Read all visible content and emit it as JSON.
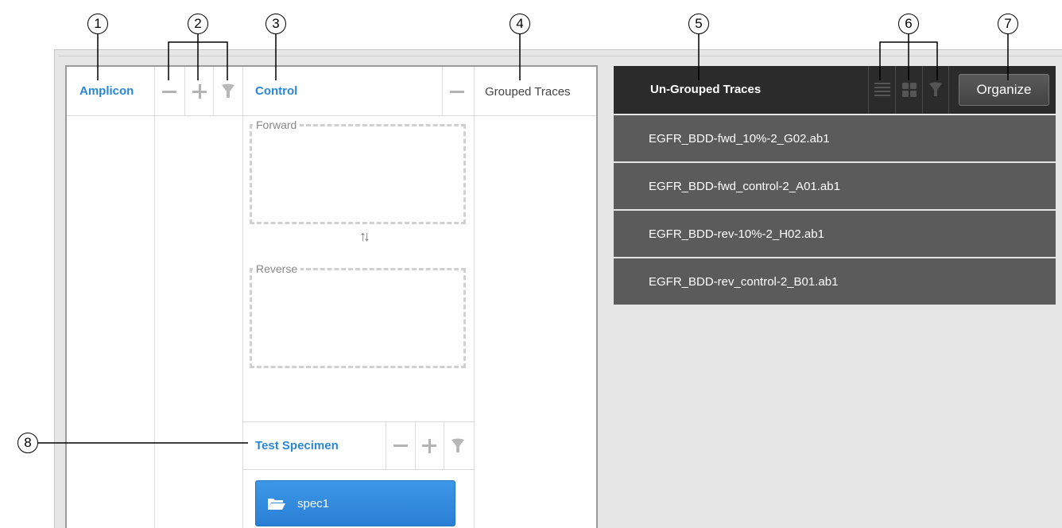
{
  "callouts": [
    "1",
    "2",
    "3",
    "4",
    "5",
    "6",
    "7",
    "8"
  ],
  "left_panel": {
    "amplicon_label": "Amplicon",
    "control_label": "Control",
    "grouped_traces_label": "Grouped Traces",
    "forward_label": "Forward",
    "reverse_label": "Reverse",
    "swap_glyph": "↑↓",
    "test_specimen_label": "Test Specimen",
    "specimen_button": "spec1"
  },
  "right_panel": {
    "title": "Un-Grouped Traces",
    "organize_label": "Organize",
    "icons": [
      "list-view-icon",
      "grid-view-icon",
      "filter-icon"
    ],
    "traces": [
      "EGFR_BDD-fwd_10%-2_G02.ab1",
      "EGFR_BDD-fwd_control-2_A01.ab1",
      "EGFR_BDD-rev-10%-2_H02.ab1",
      "EGFR_BDD-rev_control-2_B01.ab1"
    ]
  },
  "colors": {
    "accent_blue": "#2b86d6",
    "header_dark": "#2b2b2b",
    "trace_row": "#5b5b5b"
  }
}
